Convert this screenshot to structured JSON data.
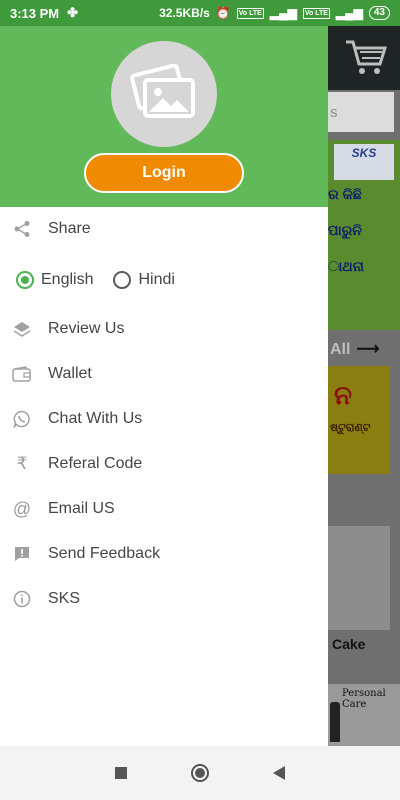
{
  "status_bar": {
    "time": "3:13 PM",
    "speed": "32.5KB/s",
    "battery": "43",
    "volte_1": "Vo LTE",
    "volte_2": "Vo LTE"
  },
  "drawer": {
    "login_label": "Login",
    "share_label": "Share",
    "languages": [
      {
        "label": "English",
        "selected": true
      },
      {
        "label": "Hindi",
        "selected": false
      }
    ],
    "items": [
      {
        "label": "Review Us",
        "icon": "layers-icon"
      },
      {
        "label": "Wallet",
        "icon": "wallet-icon"
      },
      {
        "label": "Chat With Us",
        "icon": "whatsapp-icon"
      },
      {
        "label": "Referal Code",
        "icon": "rupee-icon"
      },
      {
        "label": "Email US",
        "icon": "at-icon"
      },
      {
        "label": "Send Feedback",
        "icon": "feedback-icon"
      },
      {
        "label": "SKS",
        "icon": "info-icon"
      }
    ]
  },
  "background_app": {
    "search_placeholder": "s",
    "banner_logo": "SKS",
    "banner_lines": [
      "ର କିଛି",
      "ପାରୁନି",
      "ାଥନା"
    ],
    "view_all": "All",
    "card_title": "ନ",
    "card_sub": "ଷ୍ଟୁରାଣ୍ଟ",
    "cake_label": "Cake",
    "care_label": "Personal Care"
  },
  "colors": {
    "status_green": "#3e9a3a",
    "header_green": "#62b95a",
    "login_orange": "#f08a00",
    "radio_green": "#4caf50"
  }
}
